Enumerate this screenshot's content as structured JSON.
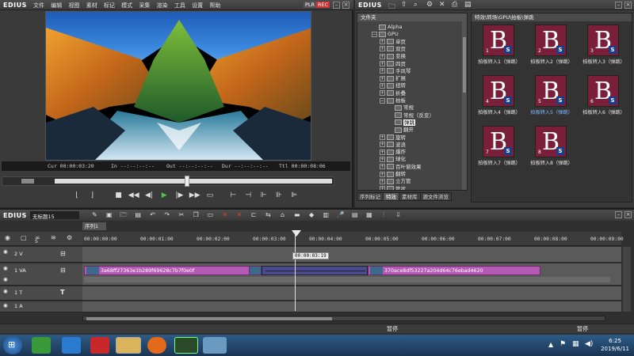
{
  "player": {
    "logo": "EDIUS",
    "menu": [
      "文件",
      "编辑",
      "视图",
      "素材",
      "标记",
      "模式",
      "采集",
      "渲染",
      "工具",
      "设置",
      "帮助"
    ],
    "plr": "PLR",
    "rec": "REC",
    "timecodes": {
      "cur_label": "Cur",
      "cur_value": "00:00:03:20",
      "in_label": "In",
      "in_value": "--:--:--:--",
      "out_label": "Out",
      "out_value": "--:--:--:--",
      "dur_label": "Dur",
      "dur_value": "--:--:--:--",
      "ttl_label": "Ttl",
      "ttl_value": "00:00:08:06"
    }
  },
  "bin": {
    "logo": "EDIUS",
    "tree_header": "文件夹",
    "path": "特效\\转场\\GPU\\拍板\\弹跳",
    "tree": [
      {
        "label": "Alpha",
        "indent": 1,
        "expand": ""
      },
      {
        "label": "GPU",
        "indent": 1,
        "expand": "−"
      },
      {
        "label": "单页",
        "indent": 2,
        "expand": "+"
      },
      {
        "label": "双页",
        "indent": 2,
        "expand": "+"
      },
      {
        "label": "变换",
        "indent": 2,
        "expand": "+"
      },
      {
        "label": "四页",
        "indent": 2,
        "expand": "+"
      },
      {
        "label": "手风琴",
        "indent": 2,
        "expand": "+"
      },
      {
        "label": "扩展",
        "indent": 2,
        "expand": "+"
      },
      {
        "label": "扭转",
        "indent": 2,
        "expand": "+"
      },
      {
        "label": "折叠",
        "indent": 2,
        "expand": "+"
      },
      {
        "label": "拍板",
        "indent": 2,
        "expand": "−"
      },
      {
        "label": "常规",
        "indent": 3,
        "expand": ""
      },
      {
        "label": "常规（反变）",
        "indent": 3,
        "expand": ""
      },
      {
        "label": "弹跳",
        "indent": 3,
        "expand": "",
        "selected": true
      },
      {
        "label": "翻开",
        "indent": 3,
        "expand": ""
      },
      {
        "label": "旋转",
        "indent": 2,
        "expand": "+"
      },
      {
        "label": "波浪",
        "indent": 2,
        "expand": "+"
      },
      {
        "label": "爆炸",
        "indent": 2,
        "expand": "+"
      },
      {
        "label": "球化",
        "indent": 2,
        "expand": "+"
      },
      {
        "label": "百叶窗效果",
        "indent": 2,
        "expand": "+"
      },
      {
        "label": "翻转",
        "indent": 2,
        "expand": "+"
      },
      {
        "label": "立方管",
        "indent": 2,
        "expand": "+"
      },
      {
        "label": "管状",
        "indent": 2,
        "expand": "+"
      }
    ],
    "tabs": [
      "序列标记",
      "特效",
      "素材库",
      "源文件浏览"
    ],
    "active_tab": 1,
    "thumbnails": [
      {
        "label": "拍板转入1（弹跳）",
        "num": "1"
      },
      {
        "label": "拍板转入2（弹跳）",
        "num": "2"
      },
      {
        "label": "拍板转入3（弹跳）",
        "num": "3"
      },
      {
        "label": "拍板转入4（弹跳）",
        "num": "4"
      },
      {
        "label": "拍板转入5（弹跳）",
        "num": "5",
        "selected": true
      },
      {
        "label": "拍板转入6（弹跳）",
        "num": "6"
      },
      {
        "label": "拍板转入7（弹跳）",
        "num": "7"
      },
      {
        "label": "拍板转入8（弹跳）",
        "num": "8"
      }
    ],
    "thumb_colors": {
      "bg": "#7a1f3a",
      "badge": "#1b3d8a"
    }
  },
  "timeline": {
    "logo": "EDIUS",
    "project": "无标题15",
    "sequence_tab": "序列1",
    "ruler": [
      "00:00:00:00",
      "00:00:01:00",
      "00:00:02:00",
      "00:00:03:00",
      "00:00:04:00",
      "00:00:05:00",
      "00:00:06:00",
      "00:00:07:00",
      "00:00:08:00",
      "00:00:09:00"
    ],
    "cursor_tc": "00:00:03:19",
    "tracks": {
      "v2": "2 V",
      "va1": "1 VA",
      "t1": "1 T",
      "a1": "1 A",
      "s_label": "S"
    },
    "clip1_name": "3a68ff27363e1b289f69628c7b7f0e0f",
    "clip2_name": "370ace8df53227a204d64c76ebad4620",
    "status_left": "暂停",
    "status_right": "暂停",
    "clip_color": "#b45ab4"
  },
  "taskbar": {
    "time": "6:25",
    "date": "2019/6/11"
  }
}
